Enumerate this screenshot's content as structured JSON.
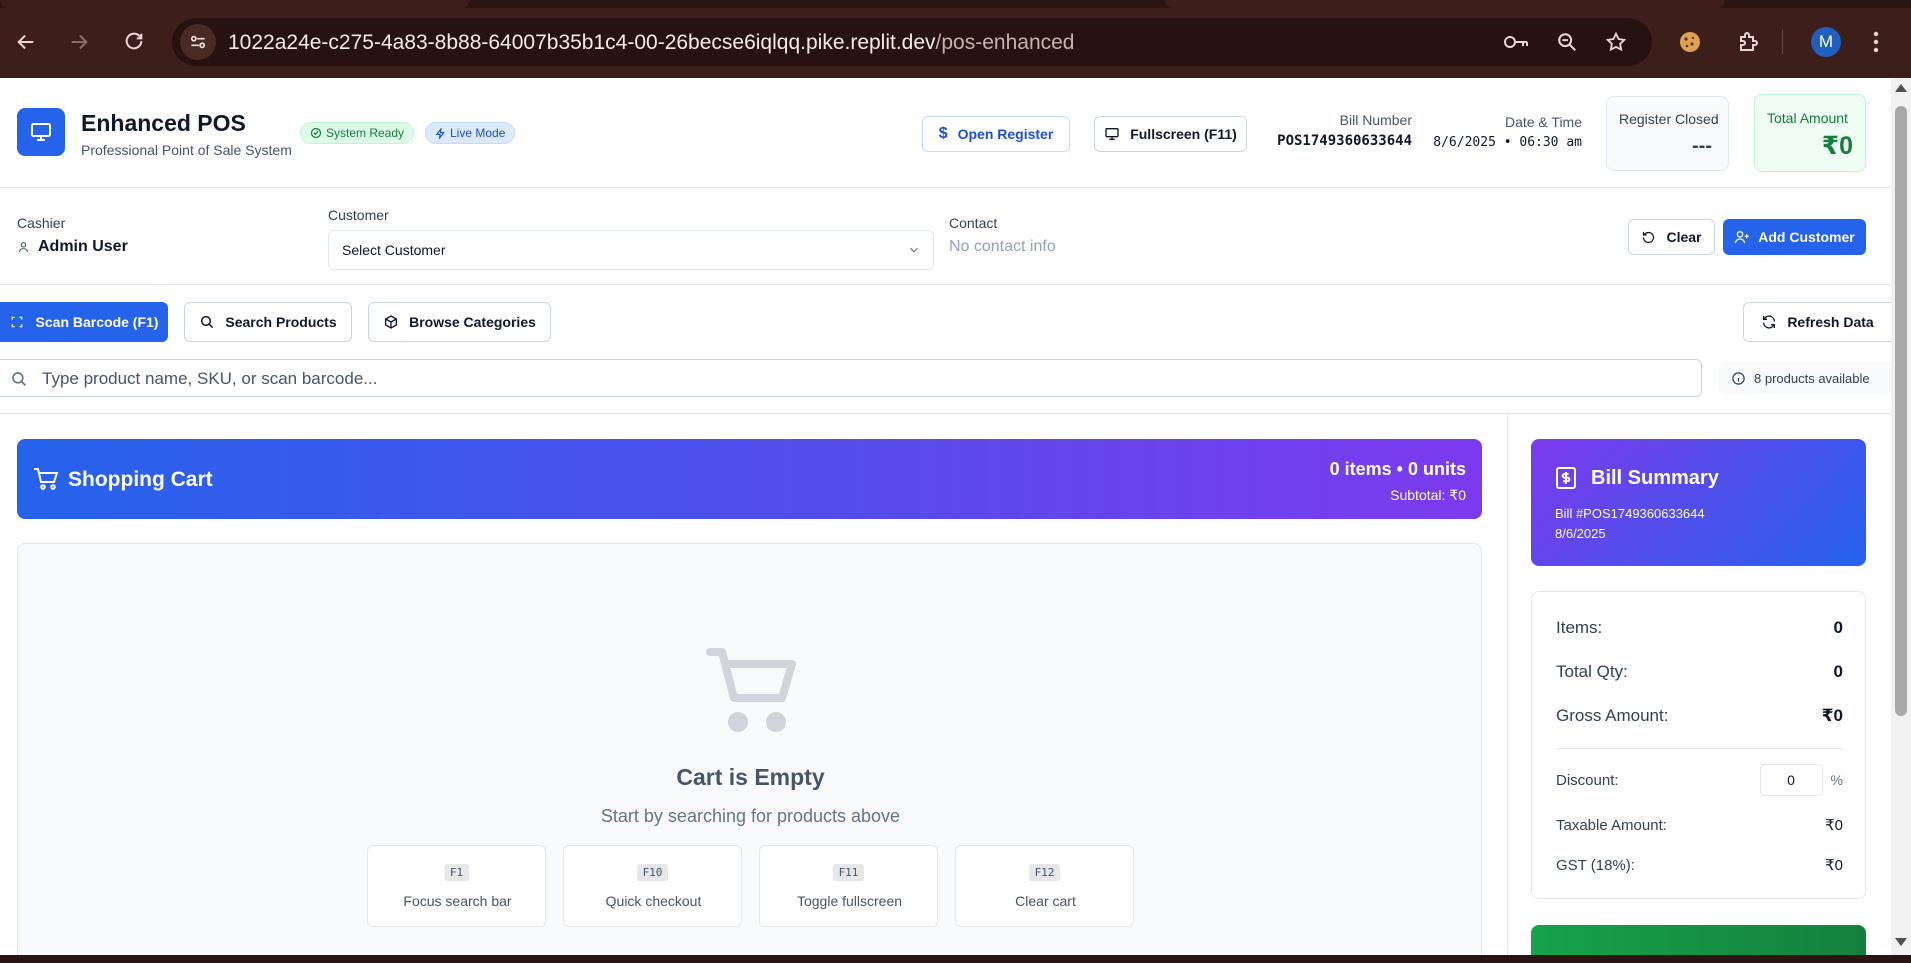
{
  "browser": {
    "url_host": "1022a24e-c275-4a83-8b88-64007b35b1c4-00-26becse6iqlqq.pike.replit.dev",
    "url_path": "/pos-enhanced",
    "profile_initial": "M"
  },
  "header": {
    "title": "Enhanced POS",
    "subtitle": "Professional Point of Sale System",
    "badge_system": "System Ready",
    "badge_live": "Live Mode",
    "open_register": "Open Register",
    "fullscreen": "Fullscreen (F11)",
    "bill_number_label": "Bill Number",
    "bill_number": "POS1749360633644",
    "datetime_label": "Date & Time",
    "datetime": "8/6/2025 • 06:30 am",
    "register_label": "Register Closed",
    "register_value": "---",
    "total_label": "Total Amount",
    "total_value": "₹0"
  },
  "customer_row": {
    "cashier_label": "Cashier",
    "cashier_name": "Admin User",
    "customer_label": "Customer",
    "customer_select": "Select Customer",
    "contact_label": "Contact",
    "contact_value": "No contact info",
    "clear": "Clear",
    "add_customer": "Add Customer"
  },
  "toolbar": {
    "scan": "Scan Barcode (F1)",
    "search": "Search Products",
    "browse": "Browse Categories",
    "refresh": "Refresh Data",
    "search_placeholder": "Type product name, SKU, or scan barcode...",
    "products_available": "8 products available"
  },
  "cart": {
    "title": "Shopping Cart",
    "count": "0 items • 0 units",
    "subtotal": "Subtotal: ₹0",
    "empty_title": "Cart is Empty",
    "empty_sub": "Start by searching for products above",
    "shortcuts": [
      {
        "key": "F1",
        "desc": "Focus search bar"
      },
      {
        "key": "F10",
        "desc": "Quick checkout"
      },
      {
        "key": "F11",
        "desc": "Toggle fullscreen"
      },
      {
        "key": "F12",
        "desc": "Clear cart"
      }
    ]
  },
  "bill": {
    "title": "Bill Summary",
    "bill_no": "Bill #POS1749360633644",
    "date": "8/6/2025",
    "items_label": "Items:",
    "items_value": "0",
    "qty_label": "Total Qty:",
    "qty_value": "0",
    "gross_label": "Gross Amount:",
    "gross_value": "₹0",
    "discount_label": "Discount:",
    "discount_value": "0",
    "discount_unit": "%",
    "taxable_label": "Taxable Amount:",
    "taxable_value": "₹0",
    "gst_label": "GST (18%):",
    "gst_value": "₹0"
  },
  "colors": {
    "primary": "#2563eb",
    "purple": "#7c3aed",
    "success": "#15803d",
    "chrome_bg": "#3c1f1b"
  }
}
